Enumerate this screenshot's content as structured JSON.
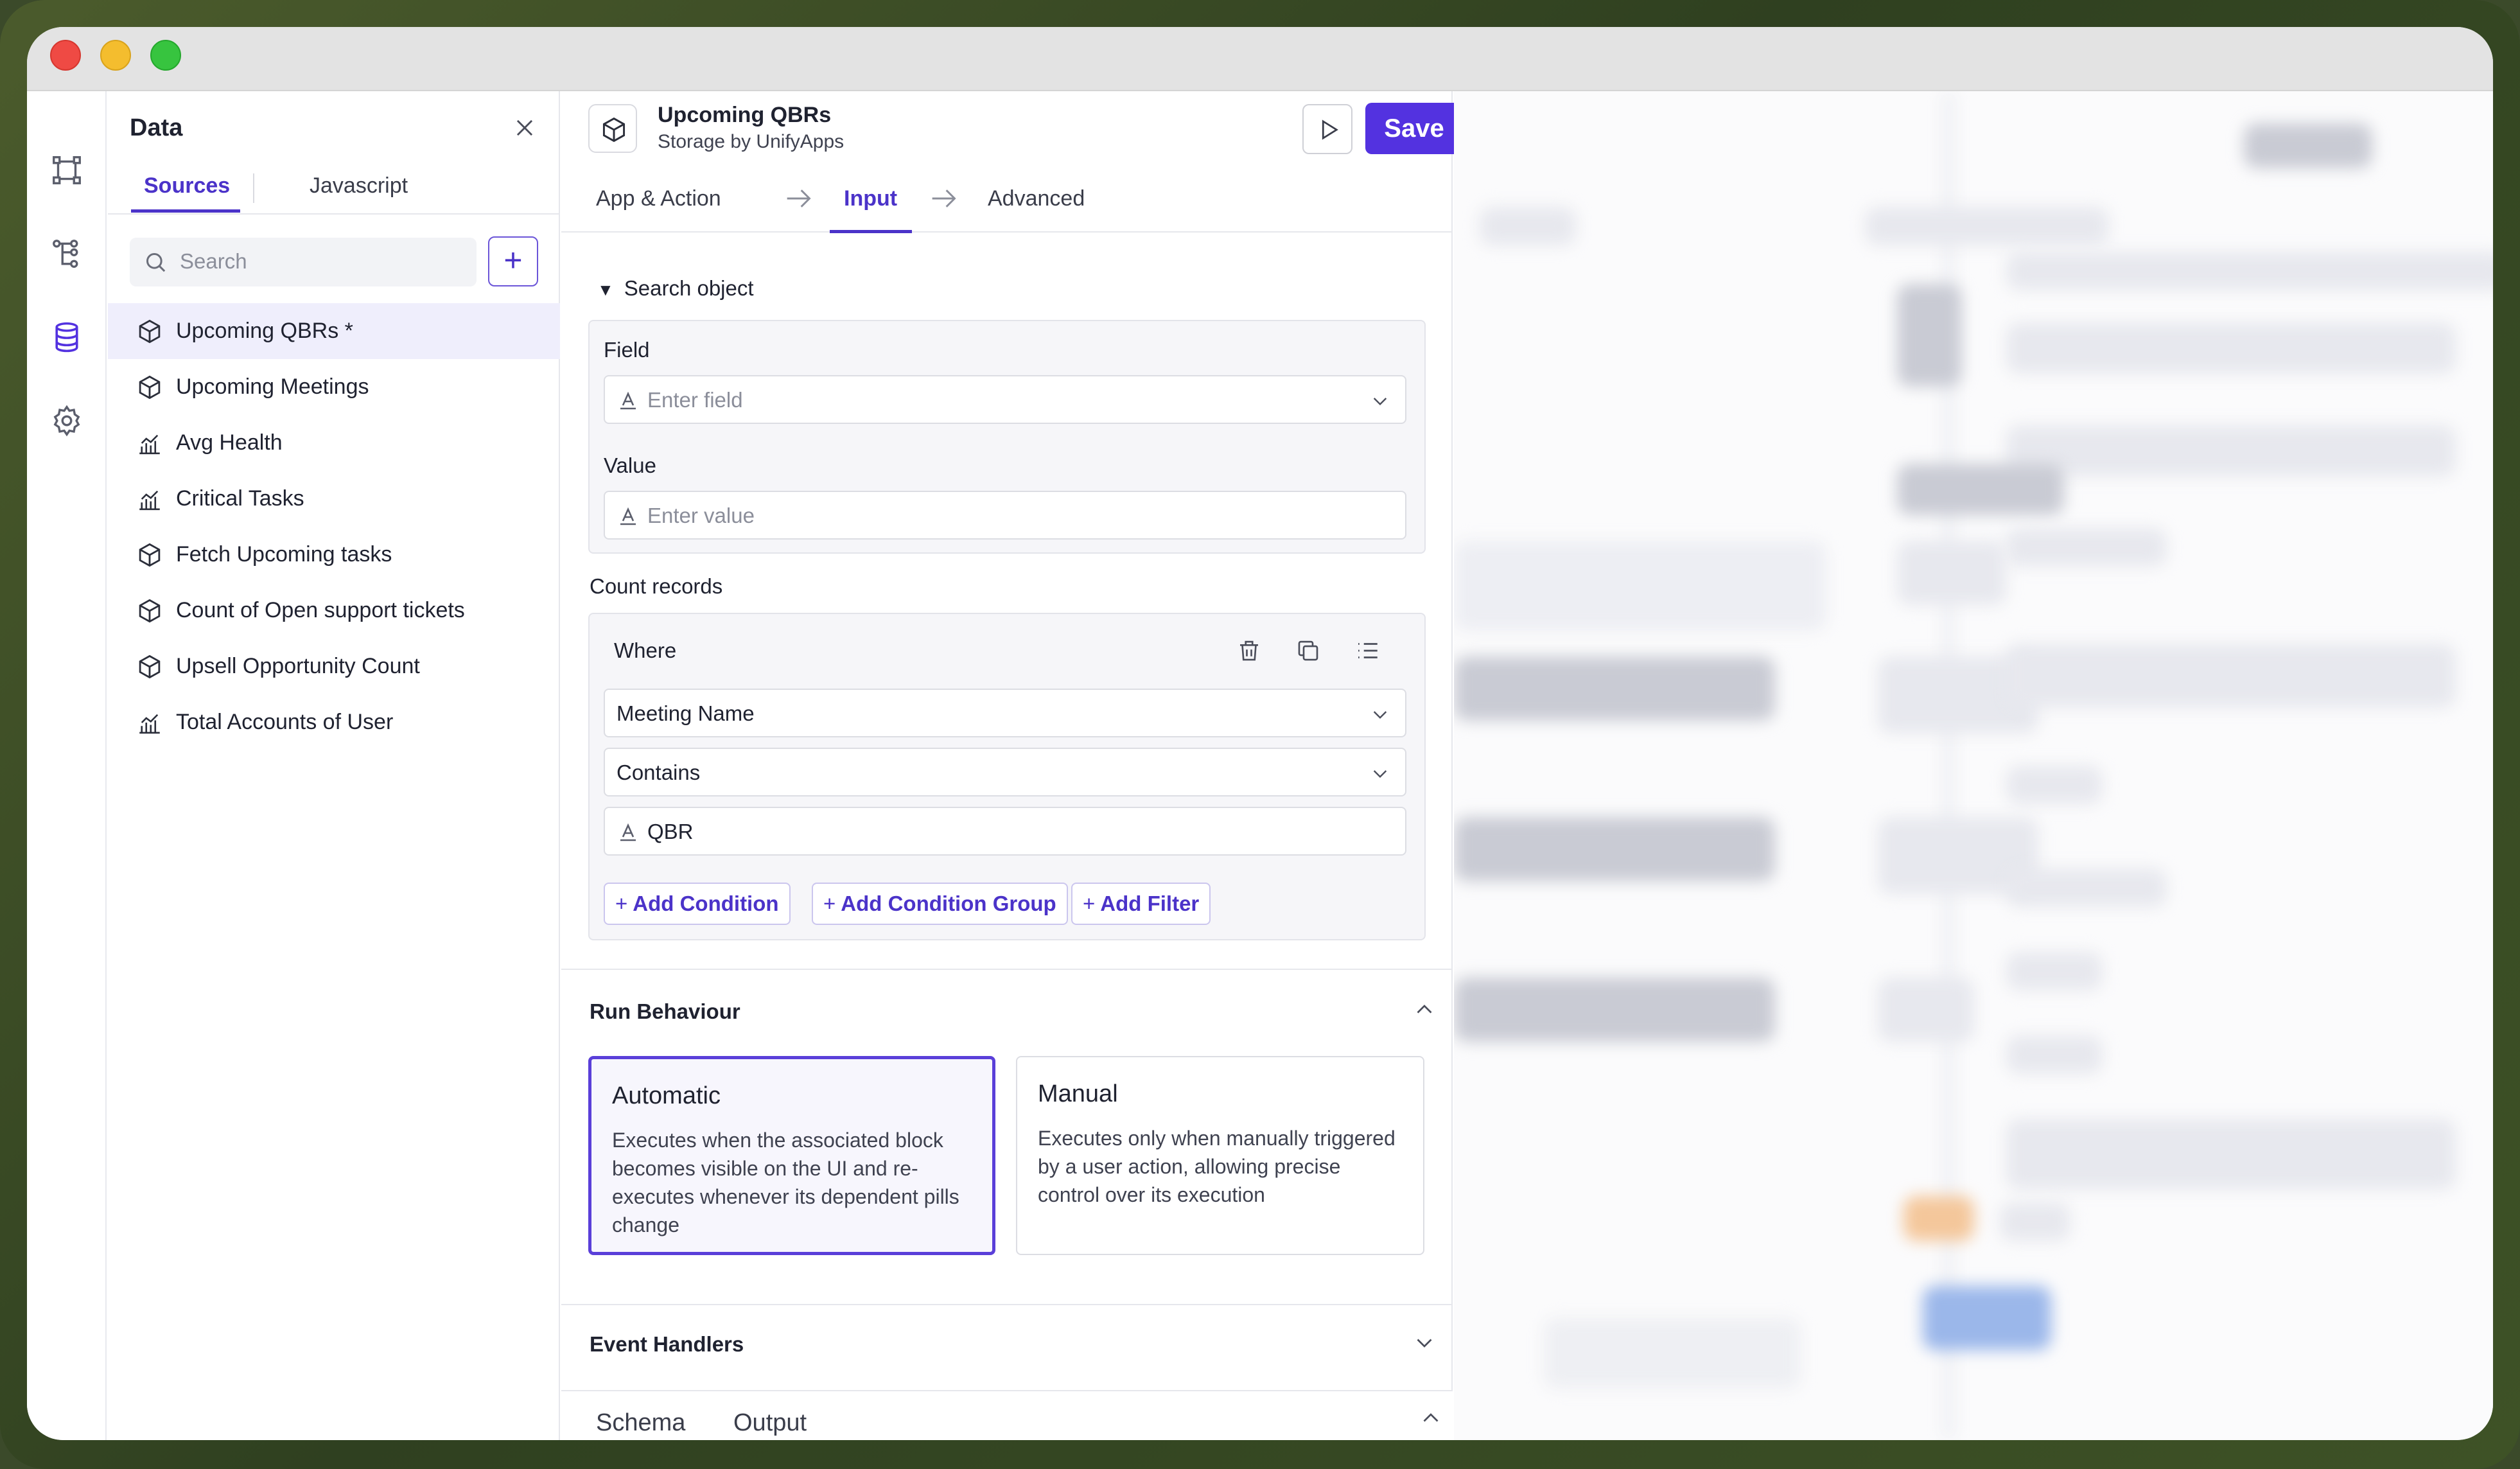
{
  "data_panel": {
    "title": "Data",
    "tabs": [
      {
        "label": "Sources",
        "active": true
      },
      {
        "label": "Javascript",
        "active": false
      }
    ],
    "search": {
      "placeholder": "Search",
      "value": ""
    },
    "sources": [
      {
        "label": "Upcoming QBRs *",
        "icon": "cube-icon",
        "active": true
      },
      {
        "label": "Upcoming Meetings",
        "icon": "cube-icon",
        "active": false
      },
      {
        "label": "Avg Health",
        "icon": "chart-icon",
        "active": false
      },
      {
        "label": "Critical Tasks",
        "icon": "chart-icon",
        "active": false
      },
      {
        "label": "Fetch Upcoming tasks",
        "icon": "cube-icon",
        "active": false
      },
      {
        "label": "Count of Open support tickets",
        "icon": "cube-icon",
        "active": false
      },
      {
        "label": "Upsell Opportunity Count",
        "icon": "cube-icon",
        "active": false
      },
      {
        "label": "Total Accounts of User",
        "icon": "chart-icon",
        "active": false
      }
    ]
  },
  "config": {
    "title": "Upcoming QBRs",
    "subtitle": "Storage by UnifyApps",
    "save_label": "Save",
    "steps": [
      {
        "label": "App & Action",
        "active": false
      },
      {
        "label": "Input",
        "active": true
      },
      {
        "label": "Advanced",
        "active": false
      }
    ],
    "search_object": {
      "toggle_label": "Search object",
      "field_label": "Field",
      "field_placeholder": "Enter field",
      "value_label": "Value",
      "value_placeholder": "Enter value"
    },
    "count_records": {
      "label": "Count records",
      "where_label": "Where",
      "condition_field": "Meeting Name",
      "condition_operator": "Contains",
      "condition_value": "QBR",
      "add_condition": "Add Condition",
      "add_condition_group": "Add Condition Group",
      "add_filter": "Add Filter"
    },
    "run_behaviour": {
      "title": "Run Behaviour",
      "options": [
        {
          "title": "Automatic",
          "description": "Executes when the associated block becomes visible on the UI and re-executes whenever its dependent pills change",
          "selected": true
        },
        {
          "title": "Manual",
          "description": "Executes only when manually triggered by a user action, allowing precise control over its execution",
          "selected": false
        }
      ]
    },
    "event_handlers_title": "Event Handlers",
    "bottom_tabs": [
      "Schema",
      "Output"
    ]
  },
  "colors": {
    "accent": "#5332e0",
    "accent_text": "#4b33c9",
    "selected_bg": "#efeefc"
  }
}
